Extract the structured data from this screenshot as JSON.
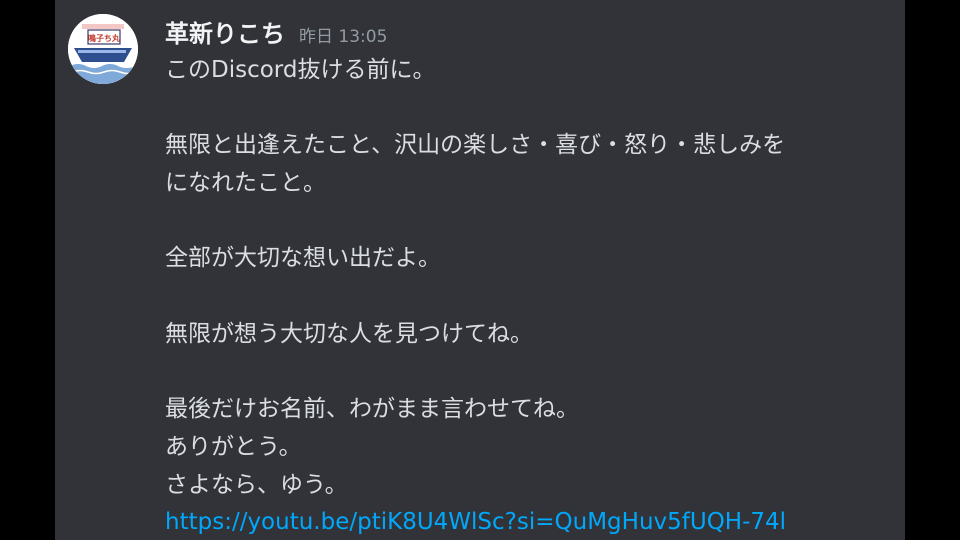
{
  "message": {
    "username": "革新りこち",
    "timestamp": "昨日 13:05",
    "lines": [
      "このDiscord抜ける前に。",
      "",
      "無限と出逢えたこと、沢山の楽しさ・喜び・怒り・悲しみを",
      "になれたこと。",
      "",
      "全部が大切な想い出だよ。",
      "",
      "無限が想う大切な人を見つけてね。",
      "",
      "最後だけお名前、わがまま言わせてね。",
      "ありがとう。",
      "さよなら、ゆう。"
    ],
    "link": "https://youtu.be/ptiK8U4WlSc?si=QuMgHuv5fUQH-74l"
  },
  "avatar": {
    "text": "鳴子ち丸"
  },
  "colors": {
    "background": "#313338",
    "outer": "#000000",
    "username": "#f2f3f5",
    "timestamp": "#949ba4",
    "text": "#dbdee1",
    "link": "#00a8fc"
  }
}
